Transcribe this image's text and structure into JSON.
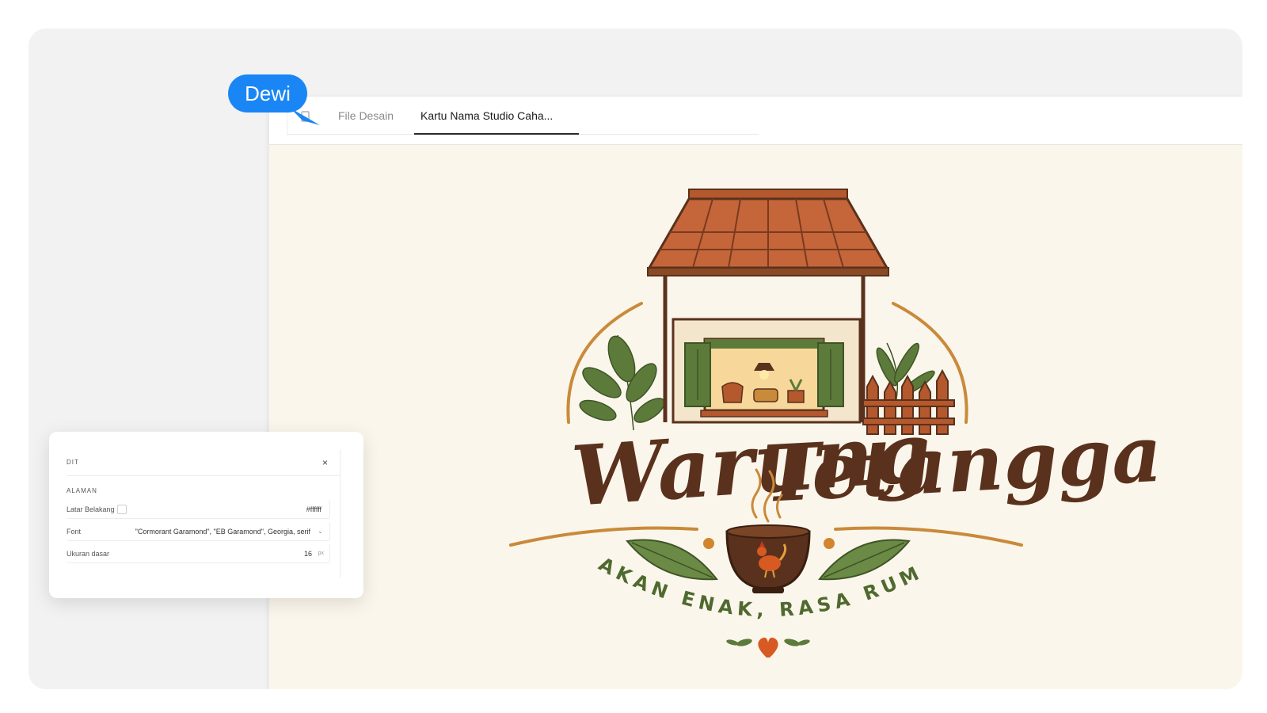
{
  "cursor": {
    "user": "Dewi",
    "color": "#1a86f5"
  },
  "tabs": [
    {
      "label": "File Desain",
      "active": false
    },
    {
      "label": "Kartu Nama Studio Caha...",
      "active": true
    }
  ],
  "logo": {
    "brand_word_1": "Warung",
    "brand_word_2": "Tetangga",
    "tagline": "MAKAN ENAK, RASA RUMAH",
    "colors": {
      "brown": "#5a311c",
      "roof": "#b4582e",
      "green": "#5c7a3a",
      "gold": "#c98a3a",
      "heart": "#d65a22",
      "bg": "#fbf6ec"
    }
  },
  "panel": {
    "header": "DIT",
    "close": "×",
    "section": "ALAMAN",
    "rows": [
      {
        "label": "Latar Belakang",
        "value": "#ffffff"
      },
      {
        "label": "Font",
        "value": "\"Cormorant Garamond\", \"EB Garamond\", Georgia, serif"
      },
      {
        "label": "Ukuran dasar",
        "value": "16",
        "unit": "px"
      }
    ]
  }
}
